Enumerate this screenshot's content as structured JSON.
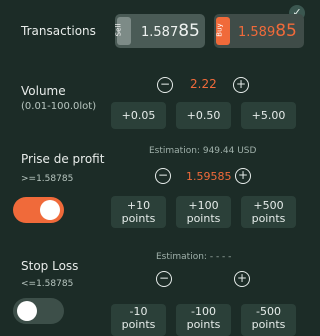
{
  "transactions": {
    "label": "Transactions",
    "sell": {
      "tag": "Sell",
      "price_main": "1.587",
      "price_big": "85"
    },
    "buy": {
      "tag": "Buy",
      "price_main": "1.589",
      "price_big": "85"
    }
  },
  "volume": {
    "label": "Volume",
    "range": "(0.01-100.0lot)",
    "value": "2.22",
    "minus": "−",
    "plus": "+",
    "increments": [
      "+0.05",
      "+0.50",
      "+5.00"
    ]
  },
  "take_profit": {
    "estimation_label": "Estimation:",
    "estimation_value": "949.44 USD",
    "label": "Prise de profit",
    "threshold": ">=1.58785",
    "value": "1.59585",
    "minus": "−",
    "plus": "+",
    "increments": [
      {
        "amount": "+10",
        "unit": "points"
      },
      {
        "amount": "+100",
        "unit": "points"
      },
      {
        "amount": "+500",
        "unit": "points"
      }
    ],
    "enabled": true
  },
  "stop_loss": {
    "estimation_label": "Estimation:",
    "estimation_value": "- - - -",
    "label": "Stop Loss",
    "threshold": "<=1.58785",
    "minus": "−",
    "plus": "+",
    "decrements": [
      {
        "amount": "-10",
        "unit": "points"
      },
      {
        "amount": "-100",
        "unit": "points"
      },
      {
        "amount": "-500",
        "unit": "points"
      }
    ],
    "enabled": false
  },
  "colors": {
    "background": "#1c2c27",
    "accent": "#f06a3a",
    "button": "#2b4039",
    "sell_panel": "#4a5b56",
    "buy_panel": "#3f4c48"
  },
  "icons": {
    "confirm": "check-badge-icon"
  }
}
